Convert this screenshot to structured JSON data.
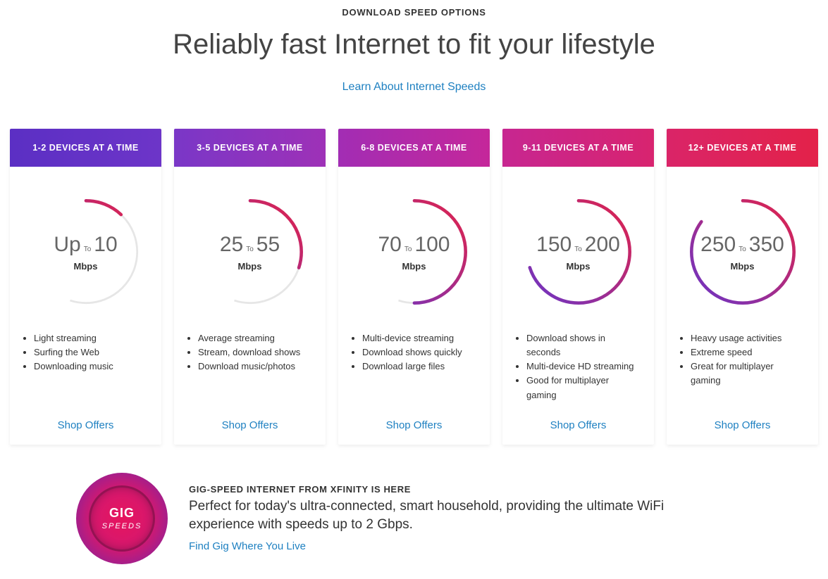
{
  "hero": {
    "eyebrow": "DOWNLOAD SPEED OPTIONS",
    "headline": "Reliably fast Internet to fit your lifestyle",
    "learn_label": "Learn About Internet Speeds"
  },
  "plans": [
    {
      "devices": "1-2 DEVICES AT A TIME",
      "lo": "Up",
      "hi": "10",
      "to": "To",
      "unit": "Mbps",
      "arc_frac": 0.12,
      "features": [
        "Light streaming",
        "Surfing the Web",
        "Downloading music"
      ],
      "shop": "Shop Offers"
    },
    {
      "devices": "3-5 DEVICES AT A TIME",
      "lo": "25",
      "hi": "55",
      "to": "To",
      "unit": "Mbps",
      "arc_frac": 0.3,
      "features": [
        "Average streaming",
        "Stream, download shows",
        "Download music/photos"
      ],
      "shop": "Shop Offers"
    },
    {
      "devices": "6-8 DEVICES AT A TIME",
      "lo": "70",
      "hi": "100",
      "to": "To",
      "unit": "Mbps",
      "arc_frac": 0.5,
      "features": [
        "Multi-device streaming",
        "Download shows quickly",
        "Download large files"
      ],
      "shop": "Shop Offers"
    },
    {
      "devices": "9-11 DEVICES AT A TIME",
      "lo": "150",
      "hi": "200",
      "to": "To",
      "unit": "Mbps",
      "arc_frac": 0.7,
      "features": [
        "Download shows in seconds",
        "Multi-device HD streaming",
        "Good for multiplayer gaming"
      ],
      "shop": "Shop Offers"
    },
    {
      "devices": "12+ DEVICES AT A TIME",
      "lo": "250",
      "hi": "350",
      "to": "To",
      "unit": "Mbps",
      "arc_frac": 0.85,
      "features": [
        "Heavy usage activities",
        "Extreme speed",
        "Great for multiplayer gaming"
      ],
      "shop": "Shop Offers"
    }
  ],
  "gig": {
    "badge_t1": "GIG",
    "badge_t2": "SPEEDS",
    "eyebrow": "GIG-SPEED INTERNET FROM XFINITY IS HERE",
    "body": "Perfect for today's ultra-connected, smart household, providing the ultimate WiFi experience with speeds up to 2 Gbps.",
    "link": "Find Gig Where You Live"
  },
  "arc": {
    "radius": 65,
    "stroke": 4,
    "grad_from": "#6a35c8",
    "grad_to": "#e32249",
    "track": "#e6e6e6"
  }
}
